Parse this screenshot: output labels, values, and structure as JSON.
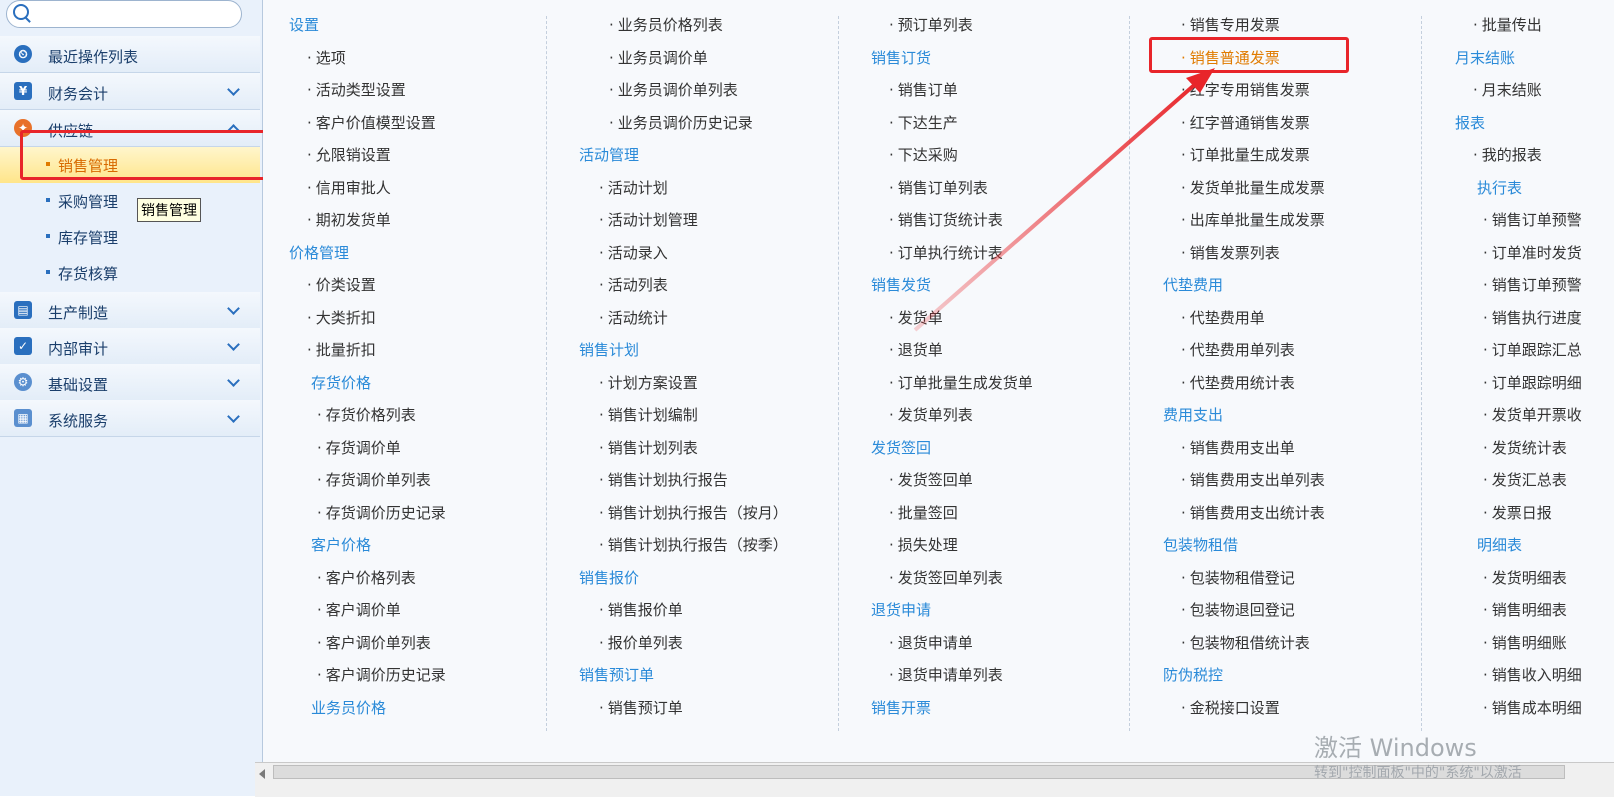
{
  "sidebar": {
    "search_placeholder": "",
    "items": [
      {
        "label": "最近操作列表"
      },
      {
        "label": "财务会计"
      },
      {
        "label": "供应链"
      },
      {
        "label": "生产制造"
      },
      {
        "label": "内部审计"
      },
      {
        "label": "基础设置"
      },
      {
        "label": "系统服务"
      }
    ],
    "subitems": [
      {
        "label": "销售管理"
      },
      {
        "label": "采购管理"
      },
      {
        "label": "库存管理"
      },
      {
        "label": "存货核算"
      }
    ],
    "tooltip": "销售管理"
  },
  "col1": {
    "cat_settings": "设置",
    "settings": [
      "选项",
      "活动类型设置",
      "客户价值模型设置",
      "允限销设置",
      "信用审批人",
      "期初发货单"
    ],
    "cat_price": "价格管理",
    "price": [
      "价类设置",
      "大类折扣",
      "批量折扣"
    ],
    "cat_stock_price": "存货价格",
    "stock_price": [
      "存货价格列表",
      "存货调价单",
      "存货调价单列表",
      "存货调价历史记录"
    ],
    "cat_customer_price": "客户价格",
    "customer_price": [
      "客户价格列表",
      "客户调价单",
      "客户调价单列表",
      "客户调价历史记录"
    ],
    "cat_sales_price": "业务员价格"
  },
  "col2": {
    "top": [
      "业务员价格列表",
      "业务员调价单",
      "业务员调价单列表",
      "业务员调价历史记录"
    ],
    "cat_activity": "活动管理",
    "activity": [
      "活动计划",
      "活动计划管理",
      "活动录入",
      "活动列表",
      "活动统计"
    ],
    "cat_plan": "销售计划",
    "plan": [
      "计划方案设置",
      "销售计划编制",
      "销售计划列表",
      "销售计划执行报告",
      "销售计划执行报告（按月）",
      "销售计划执行报告（按季）"
    ],
    "cat_quote": "销售报价",
    "quote": [
      "销售报价单",
      "报价单列表"
    ],
    "cat_preorder": "销售预订单",
    "preorder": [
      "销售预订单"
    ]
  },
  "col3": {
    "top": [
      "预订单列表"
    ],
    "cat_order": "销售订货",
    "order": [
      "销售订单",
      "下达生产",
      "下达采购",
      "销售订单列表",
      "销售订货统计表",
      "订单执行统计表"
    ],
    "cat_ship": "销售发货",
    "ship": [
      "发货单",
      "退货单",
      "订单批量生成发货单",
      "发货单列表"
    ],
    "cat_sign": "发货签回",
    "sign": [
      "发货签回单",
      "批量签回",
      "损失处理",
      "发货签回单列表"
    ],
    "cat_return": "退货申请",
    "return": [
      "退货申请单",
      "退货申请单列表"
    ],
    "cat_invoice": "销售开票"
  },
  "col4": {
    "top": [
      "销售专用发票",
      "销售普通发票",
      "红字专用销售发票",
      "红字普通销售发票",
      "订单批量生成发票",
      "发货单批量生成发票",
      "出库单批量生成发票",
      "销售发票列表"
    ],
    "cat_advance": "代垫费用",
    "advance": [
      "代垫费用单",
      "代垫费用单列表",
      "代垫费用统计表"
    ],
    "cat_expense": "费用支出",
    "expense": [
      "销售费用支出单",
      "销售费用支出单列表",
      "销售费用支出统计表"
    ],
    "cat_pack": "包装物租借",
    "pack": [
      "包装物租借登记",
      "包装物退回登记",
      "包装物租借统计表"
    ],
    "cat_tax": "防伪税控",
    "tax": [
      "金税接口设置"
    ]
  },
  "col5": {
    "top": [
      "批量传出"
    ],
    "cat_month": "月末结账",
    "month": [
      "月末结账"
    ],
    "cat_report": "报表",
    "report": [
      "我的报表"
    ],
    "cat_exec": "执行表",
    "exec": [
      "销售订单预警",
      "订单准时发货",
      "销售订单预警",
      "销售执行进度",
      "订单跟踪汇总",
      "订单跟踪明细",
      "发货单开票收",
      "发货统计表",
      "发货汇总表",
      "发票日报"
    ],
    "cat_detail": "明细表",
    "detail": [
      "发货明细表",
      "销售明细表",
      "销售明细账",
      "销售收入明细",
      "销售成本明细"
    ]
  },
  "watermark": {
    "line1": "激活 Windows",
    "line2": "转到\"控制面板\"中的\"系统\"以激活"
  },
  "colors": {
    "highlight": "#e8252a",
    "category": "#2a8ad8",
    "active": "#e07b00"
  }
}
